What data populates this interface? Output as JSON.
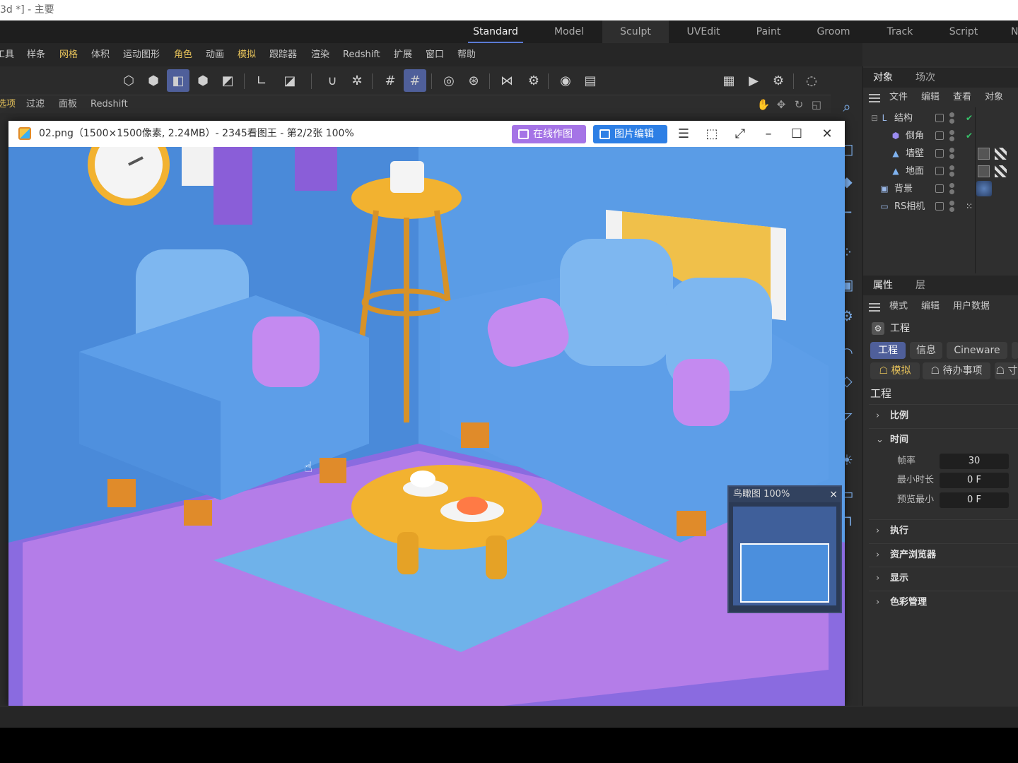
{
  "app": {
    "title": "3d *] - 主要"
  },
  "layouts": [
    {
      "label": "Standard",
      "active": true
    },
    {
      "label": "Model"
    },
    {
      "label": "Sculpt"
    },
    {
      "label": "UVEdit"
    },
    {
      "label": "Paint"
    },
    {
      "label": "Groom"
    },
    {
      "label": "Track"
    },
    {
      "label": "Script"
    },
    {
      "label": "N"
    }
  ],
  "menu": [
    "工具",
    "样条",
    "网格",
    "体积",
    "运动图形",
    "角色",
    "动画",
    "模拟",
    "跟踪器",
    "渲染",
    "Redshift",
    "扩展",
    "窗口",
    "帮助"
  ],
  "viewport_menu": [
    "选项",
    "过滤",
    "面板",
    "Redshift"
  ],
  "viewer": {
    "title": "02.png（1500×1500像素, 2.24MB）- 2345看图王 - 第2/2张 100%",
    "online_btn": "在线作图",
    "edit_btn": "图片编辑",
    "minimap_title": "鸟瞰图 100%",
    "minimap_close": "×"
  },
  "object_panel": {
    "tabs": [
      "对象",
      "场次"
    ],
    "menu": [
      "文件",
      "编辑",
      "查看",
      "对象"
    ],
    "objects": [
      {
        "name": "结构",
        "icon": "null-object-icon"
      },
      {
        "name": "倒角",
        "icon": "bevel-icon"
      },
      {
        "name": "墙壁",
        "icon": "wall-icon"
      },
      {
        "name": "地面",
        "icon": "floor-icon"
      },
      {
        "name": "背景",
        "icon": "background-icon"
      },
      {
        "name": "RS相机",
        "icon": "camera-icon"
      }
    ]
  },
  "attr_panel": {
    "tabs": [
      "属性",
      "层"
    ],
    "menu": [
      "模式",
      "编辑",
      "用户数据"
    ],
    "title": "工程",
    "pills": [
      "工程",
      "信息",
      "Cineware"
    ],
    "pills2": [
      "模拟",
      "待办事项",
      "寸"
    ],
    "section": "工程",
    "groups": [
      "比例",
      "时间",
      "执行",
      "资产浏览器",
      "显示",
      "色彩管理"
    ],
    "fields": [
      {
        "label": "帧率",
        "value": "30"
      },
      {
        "label": "最小时长",
        "value": "0 F"
      },
      {
        "label": "预览最小",
        "value": "0 F"
      }
    ]
  },
  "colors": {
    "accent": "#4f5f9a",
    "highlight": "#e6c25a",
    "viewer_purple": "#a574e6",
    "viewer_blue": "#2d7fe5"
  }
}
